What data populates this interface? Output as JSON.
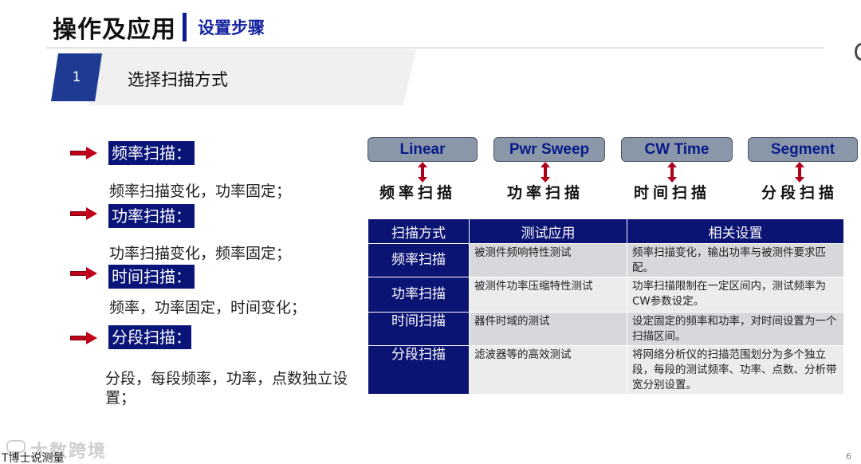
{
  "header": {
    "title": "操作及应用",
    "subtitle": "设置步骤"
  },
  "step": {
    "number": "1",
    "title": "选择扫描方式"
  },
  "sweep_list": [
    {
      "label": "频率扫描：",
      "description": "频率扫描变化，功率固定；"
    },
    {
      "label": "功率扫描：",
      "description": "功率扫描变化，频率固定；"
    },
    {
      "label": "时间扫描：",
      "description": "频率，功率固定，时间变化；"
    },
    {
      "label": "分段扫描：",
      "description": "分段，每段频率，功率，点数独立设置；"
    }
  ],
  "modes": [
    {
      "button": "Linear",
      "chinese": "频率扫描"
    },
    {
      "button": "Pwr Sweep",
      "chinese": "功率扫描"
    },
    {
      "button": "CW Time",
      "chinese": "时间扫描"
    },
    {
      "button": "Segment",
      "chinese": "分段扫描"
    }
  ],
  "table": {
    "headers": [
      "扫描方式",
      "测试应用",
      "相关设置"
    ],
    "rows": [
      {
        "mode": "频率扫描",
        "application": "被测件频响特性测试",
        "settings": "频率扫描变化，输出功率与被测件要求匹配。"
      },
      {
        "mode": "功率扫描",
        "application": "被测件功率压缩特性测试",
        "settings": "功率扫描限制在一定区间内，测试频率为CW参数设定。"
      },
      {
        "mode": "时间扫描",
        "application": "器件时域的测试",
        "settings": "设定固定的频率和功率，对时间设置为一个扫描区间。"
      },
      {
        "mode": "分段扫描",
        "application": "滤波器等的高效测试",
        "settings": "将网络分析仪的扫描范围划分为多个独立段，每段的测试频率、功率、点数、分析带宽分别设置。"
      }
    ]
  },
  "footer": {
    "watermark": "大数跨境",
    "source": "T博士说测量",
    "page_number": "6"
  }
}
